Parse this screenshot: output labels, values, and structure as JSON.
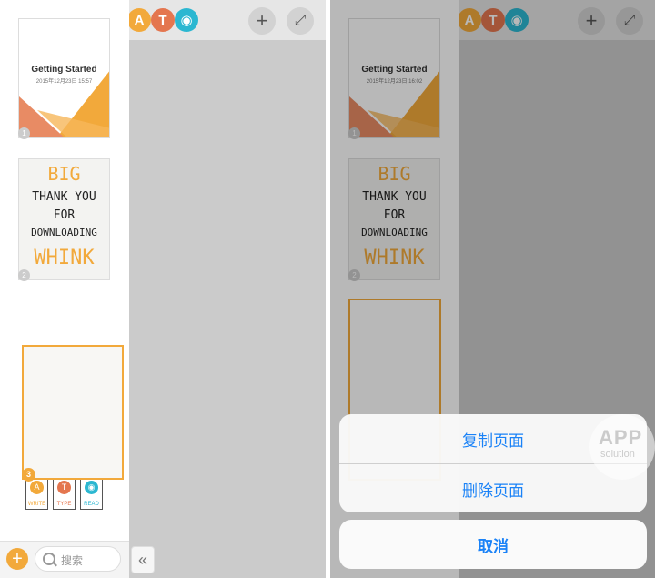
{
  "toolbar": {
    "tools": [
      {
        "icon": "pencil-icon",
        "glyph": "A",
        "color": "#f2a93b"
      },
      {
        "icon": "text-icon",
        "glyph": "T",
        "color": "#e4764f"
      },
      {
        "icon": "eye-icon",
        "glyph": "◉",
        "color": "#2bb7d1"
      }
    ],
    "add_glyph": "+",
    "expand_glyph": "⤢"
  },
  "pages": [
    {
      "number": "1",
      "title": "Getting Started",
      "date_left": "2015年12月23日 15:57",
      "date_right": "2015年12月23日 16:02"
    },
    {
      "number": "2",
      "line1": "BIG",
      "line2": "THANK YOU",
      "line3": "FOR",
      "line4": "DOWNLOADING",
      "line5": "WHINK"
    },
    {
      "number": "3",
      "mini_labels": [
        "WRITE",
        "TYPE",
        "READ"
      ]
    }
  ],
  "bottom_bar": {
    "add_glyph": "+",
    "search_placeholder": "搜索",
    "collapse_glyph": "«"
  },
  "action_sheet": {
    "duplicate_label": "复制页面",
    "delete_label": "删除页面",
    "cancel_label": "取消"
  },
  "watermark": {
    "main": "APP",
    "sub": "solution"
  },
  "colors": {
    "accent": "#f2a93b",
    "action_blue": "#1a82f7",
    "text_tool": "#e4764f",
    "read_tool": "#2bb7d1"
  }
}
